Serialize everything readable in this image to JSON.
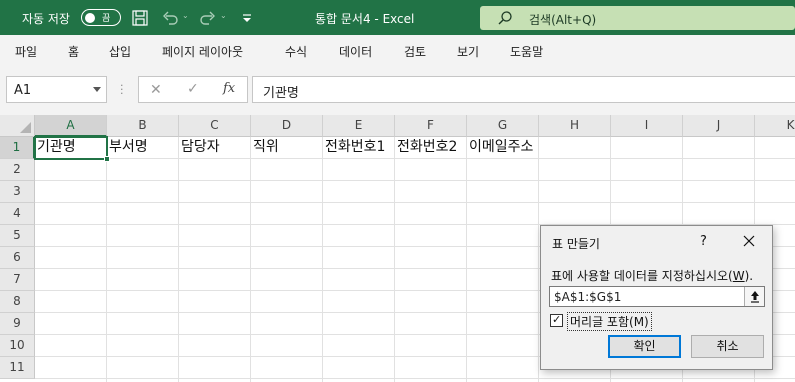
{
  "titlebar": {
    "autosave_label": "자동 저장",
    "autosave_state": "끔",
    "doc_title": "통합 문서4  -  Excel",
    "search_placeholder": "검색(Alt+Q)",
    "bg_color": "#217346",
    "icons": [
      "save-icon",
      "undo-icon",
      "redo-icon",
      "customize-qat-icon",
      "search-icon"
    ]
  },
  "menu": {
    "items": [
      "파일",
      "홈",
      "삽입",
      "페이지 레이아웃",
      "수식",
      "데이터",
      "검토",
      "보기",
      "도움말"
    ]
  },
  "formula_bar": {
    "name_box": "A1",
    "fx_label": "fx",
    "formula_value": "기관명"
  },
  "grid": {
    "columns": [
      "A",
      "B",
      "C",
      "D",
      "E",
      "F",
      "G",
      "H",
      "I",
      "J",
      "K"
    ],
    "rows": [
      "1",
      "2",
      "3",
      "4",
      "5",
      "6",
      "7",
      "8",
      "9",
      "10",
      "11"
    ],
    "active_cell": "A1",
    "row1_cells": [
      "기관명",
      "부서명",
      "담당자",
      "직위",
      "전화번호1",
      "전화번호2",
      "이메일주소"
    ]
  },
  "dialog": {
    "title": "표 만들기",
    "help": "?",
    "prompt": "표에 사용할 데이터를 지정하십시오(",
    "prompt_key": "W",
    "prompt_end": ").",
    "range_value": "$A$1:$G$1",
    "header_checkbox_label": "머리글 포함(M)",
    "header_checkbox_checked": true,
    "ok_label": "확인",
    "cancel_label": "취소"
  }
}
